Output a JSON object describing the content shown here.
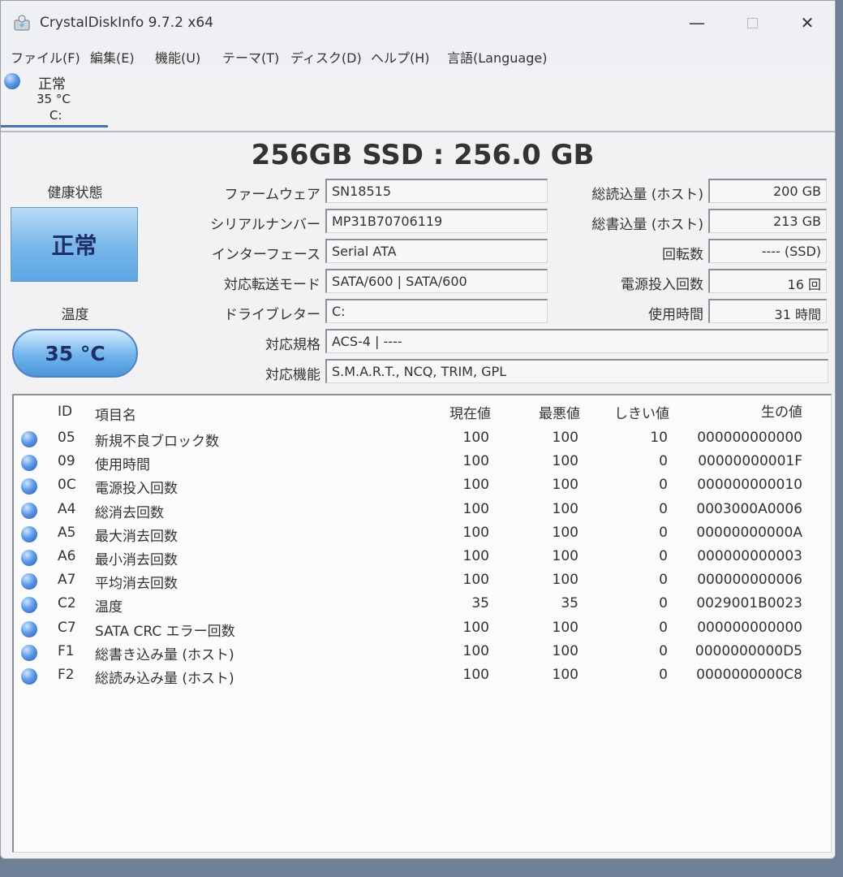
{
  "window": {
    "title": "CrystalDiskInfo 9.7.2 x64"
  },
  "menu": [
    "ファイル(F)",
    "編集(E)",
    "機能(U)",
    "テーマ(T)",
    "ディスク(D)",
    "ヘルプ(H)",
    "言語(Language)"
  ],
  "disk_tab": {
    "status": "正常",
    "temp": "35 °C",
    "drive": "C:"
  },
  "model": "256GB SSD : 256.0 GB",
  "health": {
    "label": "健康状態",
    "value": "正常"
  },
  "temperature": {
    "label": "温度",
    "value": "35 °C"
  },
  "left_fields": [
    {
      "label": "ファームウェア",
      "value": "SN18515"
    },
    {
      "label": "シリアルナンバー",
      "value": "MP31B70706119"
    },
    {
      "label": "インターフェース",
      "value": "Serial ATA"
    },
    {
      "label": "対応転送モード",
      "value": "SATA/600 | SATA/600"
    },
    {
      "label": "ドライブレター",
      "value": "C:"
    },
    {
      "label": "対応規格",
      "value": "ACS-4 | ----"
    },
    {
      "label": "対応機能",
      "value": "S.M.A.R.T., NCQ, TRIM, GPL"
    }
  ],
  "right_fields": [
    {
      "label": "総読込量 (ホスト)",
      "value": "200 GB"
    },
    {
      "label": "総書込量 (ホスト)",
      "value": "213 GB"
    },
    {
      "label": "回転数",
      "value": "---- (SSD)"
    },
    {
      "label": "電源投入回数",
      "value": "16 回"
    },
    {
      "label": "使用時間",
      "value": "31 時間"
    }
  ],
  "smart": {
    "headers": {
      "id": "ID",
      "name": "項目名",
      "current": "現在値",
      "worst": "最悪値",
      "threshold": "しきい値",
      "raw": "生の値"
    },
    "rows": [
      {
        "id": "05",
        "name": "新規不良ブロック数",
        "current": "100",
        "worst": "100",
        "threshold": "10",
        "raw": "000000000000"
      },
      {
        "id": "09",
        "name": "使用時間",
        "current": "100",
        "worst": "100",
        "threshold": "0",
        "raw": "00000000001F"
      },
      {
        "id": "0C",
        "name": "電源投入回数",
        "current": "100",
        "worst": "100",
        "threshold": "0",
        "raw": "000000000010"
      },
      {
        "id": "A4",
        "name": "総消去回数",
        "current": "100",
        "worst": "100",
        "threshold": "0",
        "raw": "0003000A0006"
      },
      {
        "id": "A5",
        "name": "最大消去回数",
        "current": "100",
        "worst": "100",
        "threshold": "0",
        "raw": "00000000000A"
      },
      {
        "id": "A6",
        "name": "最小消去回数",
        "current": "100",
        "worst": "100",
        "threshold": "0",
        "raw": "000000000003"
      },
      {
        "id": "A7",
        "name": "平均消去回数",
        "current": "100",
        "worst": "100",
        "threshold": "0",
        "raw": "000000000006"
      },
      {
        "id": "C2",
        "name": "温度",
        "current": "35",
        "worst": "35",
        "threshold": "0",
        "raw": "0029001B0023"
      },
      {
        "id": "C7",
        "name": "SATA CRC エラー回数",
        "current": "100",
        "worst": "100",
        "threshold": "0",
        "raw": "000000000000"
      },
      {
        "id": "F1",
        "name": "総書き込み量 (ホスト)",
        "current": "100",
        "worst": "100",
        "threshold": "0",
        "raw": "0000000000D5"
      },
      {
        "id": "F2",
        "name": "総読み込み量 (ホスト)",
        "current": "100",
        "worst": "100",
        "threshold": "0",
        "raw": "0000000000C8"
      }
    ]
  },
  "colors": {
    "health_blue": "#7ab8ea",
    "status_dot": "#5a97e6",
    "text_navy": "#1d2f66"
  }
}
